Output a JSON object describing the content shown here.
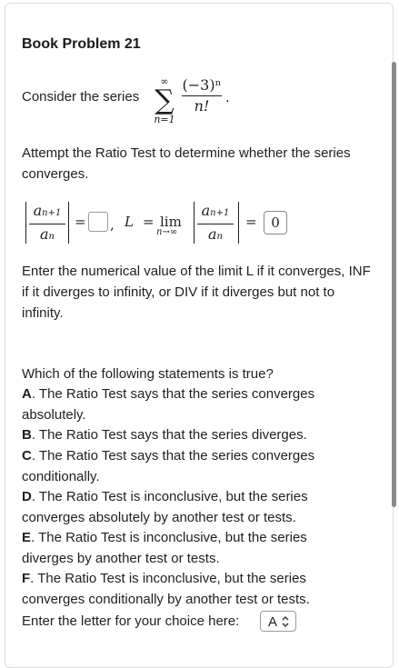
{
  "problem": {
    "title": "Book Problem 21",
    "consider_text": "Consider the series",
    "series": {
      "upper": "∞",
      "lower": "n=1",
      "numerator": "(−3)ⁿ",
      "denominator": "n!",
      "trailing": "."
    },
    "instruction": "Attempt the Ratio Test to determine whether the series converges.",
    "ratio": {
      "num_base": "a",
      "num_sub": "n+1",
      "den_base": "a",
      "den_sub": "n",
      "equals": "=",
      "comma": ",",
      "L_label": "L",
      "lim": "lim",
      "lim_sub": "n→∞",
      "limit_value": "0"
    },
    "enter_text": "Enter the numerical value of the limit L if it converges, INF if it diverges to infinity, or DIV if it diverges but not to infinity."
  },
  "question": {
    "prompt": "Which of the following statements is true?",
    "options": [
      {
        "letter": "A",
        "text": ". The Ratio Test says that the series converges absolutely."
      },
      {
        "letter": "B",
        "text": ". The Ratio Test says that the series diverges."
      },
      {
        "letter": "C",
        "text": ". The Ratio Test says that the series converges conditionally."
      },
      {
        "letter": "D",
        "text": ". The Ratio Test is inconclusive, but the series converges absolutely by another test or tests."
      },
      {
        "letter": "E",
        "text": ". The Ratio Test is inconclusive, but the series diverges by another test or tests."
      },
      {
        "letter": "F",
        "text": ". The Ratio Test is inconclusive, but the series converges conditionally by another test or tests."
      }
    ],
    "choice_label": "Enter the letter for your choice here:",
    "choice_value": "A"
  },
  "icons": {
    "select_chevron": "chevron-updown-icon"
  }
}
